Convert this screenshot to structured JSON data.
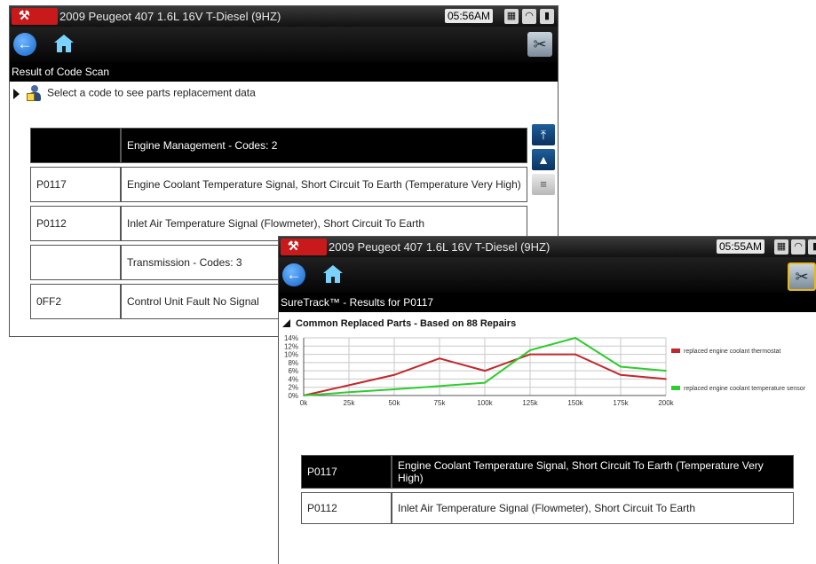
{
  "window1": {
    "status": {
      "title": "2009 Peugeot 407 1.6L 16V T-Diesel  (9HZ)",
      "time": "05:56AM"
    },
    "subtitle": "Result of Code Scan",
    "hint": "Select a code to see parts replacement data",
    "rows": [
      {
        "code": "",
        "description": "Engine Management - Codes: 2",
        "header": true
      },
      {
        "code": "P0117",
        "description": "Engine Coolant Temperature Signal, Short Circuit To Earth (Temperature Very High)",
        "header": false
      },
      {
        "code": "P0112",
        "description": "Inlet Air Temperature Signal (Flowmeter), Short Circuit To Earth",
        "header": false
      },
      {
        "code": "",
        "description": "Transmission - Codes: 3",
        "header": false
      },
      {
        "code": "0FF2",
        "description": "Control Unit Fault No Signal",
        "header": false
      }
    ]
  },
  "window2": {
    "status": {
      "title": "2009 Peugeot 407 1.6L 16V T-Diesel  (9HZ)",
      "time": "05:55AM"
    },
    "subtitle": "SureTrack™ - Results for P0117",
    "chart_title": "Common Replaced Parts - Based on 88 Repairs",
    "rows": [
      {
        "code": "P0117",
        "description": "Engine Coolant Temperature Signal, Short Circuit To Earth (Temperature Very High)",
        "header": true
      },
      {
        "code": "P0112",
        "description": "Inlet Air Temperature Signal (Flowmeter), Short Circuit To Earth",
        "header": false
      }
    ]
  },
  "chart_data": {
    "type": "line",
    "title": "Common Replaced Parts - Based on 88 Repairs",
    "x": [
      0,
      25,
      50,
      75,
      100,
      125,
      150,
      175,
      200
    ],
    "x_tick_labels": [
      "0k",
      "25k",
      "50k",
      "75k",
      "100k",
      "125k",
      "150k",
      "175k",
      "200k"
    ],
    "y_tick_labels": [
      "0%",
      "2%",
      "4%",
      "6%",
      "8%",
      "10%",
      "12%",
      "14%"
    ],
    "xlim": [
      0,
      200
    ],
    "ylim": [
      0,
      14
    ],
    "grid": true,
    "legend_placement": "right",
    "series": [
      {
        "name": "replaced engine coolant thermostat",
        "color": "#c0282c",
        "values": [
          0,
          2.5,
          5,
          9,
          6,
          10,
          10,
          5,
          4
        ]
      },
      {
        "name": "replaced engine coolant temperature sensor",
        "color": "#2ecc2e",
        "values": [
          0,
          0.8,
          1.5,
          2.3,
          3.1,
          11,
          14,
          7,
          6
        ]
      }
    ]
  },
  "colors": {
    "accent_red": "#c8191b",
    "toolbar": "#111111",
    "header_row": "#000000",
    "scroll_button": "#1f5e9a"
  },
  "icons": {
    "logo": "snap-on-logo-icon",
    "back": "back-arrow-icon",
    "home": "home-icon",
    "tool": "wrench-tools-icon",
    "battery": "battery-icon",
    "wifi": "wifi-icon",
    "network": "network-icon"
  }
}
